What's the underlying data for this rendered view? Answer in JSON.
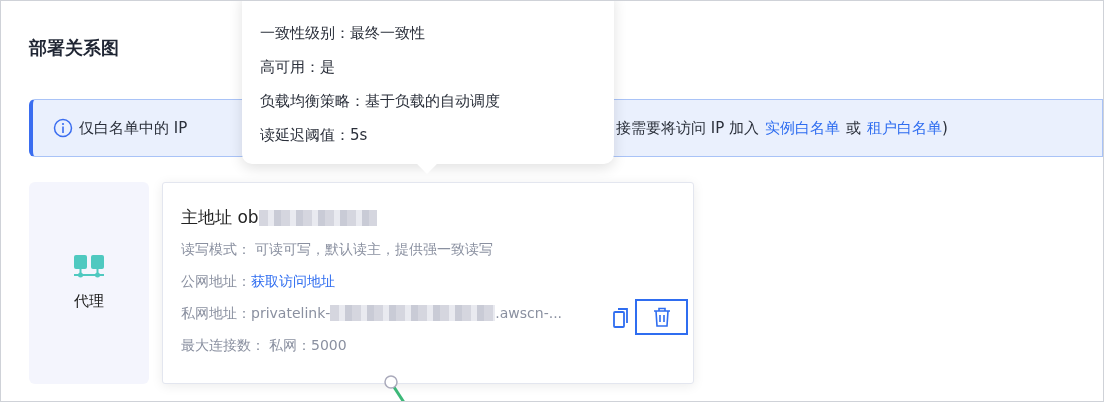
{
  "section_title": "部署关系图",
  "alert": {
    "text_start": "仅白名单中的 IP",
    "text_end": "接需要将访问 IP 加入",
    "link_1": "实例白名单",
    "separator": "或",
    "link_2": "租户白名单",
    "close_paren": ")"
  },
  "tooltip": {
    "lines": [
      "一致性级别：最终一致性",
      "高可用：是",
      "负载均衡策略：基于负载的自动调度",
      "读延迟阈值：5s"
    ]
  },
  "proxy": {
    "label": "代理"
  },
  "node": {
    "title": "主地址 ob",
    "rows": [
      {
        "kind": "text",
        "label": "读写模式：",
        "value": "可读可写，默认读主，提供强一致读写"
      },
      {
        "kind": "link",
        "label": "公网地址：",
        "value": "获取访问地址"
      },
      {
        "kind": "address",
        "label": "私网地址：",
        "value": "privatelink-",
        "value_end": ".awscn-..."
      },
      {
        "kind": "text",
        "label": "最大连接数：",
        "value": "私网：5000"
      }
    ]
  }
}
